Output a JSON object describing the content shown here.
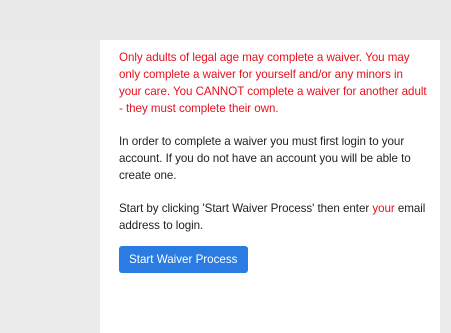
{
  "notice": {
    "warning_text": "Only adults of legal age may complete a waiver. You may only complete a waiver for yourself and/or any minors in your care. You CANNOT complete a waiver for another adult - they must complete their own."
  },
  "instructions": {
    "login_text": "In order to complete a waiver you must first login to your account. If you do not have an account you will be able to create one.",
    "start_text_part1": "Start by clicking 'Start Waiver Process' then enter ",
    "start_text_accent": "your",
    "start_text_part2": " email address to login."
  },
  "actions": {
    "start_button_label": "Start Waiver Process"
  },
  "colors": {
    "warning": "#e8101d",
    "button": "#2a7be2",
    "card": "#ffffff",
    "background": "#ececed"
  }
}
